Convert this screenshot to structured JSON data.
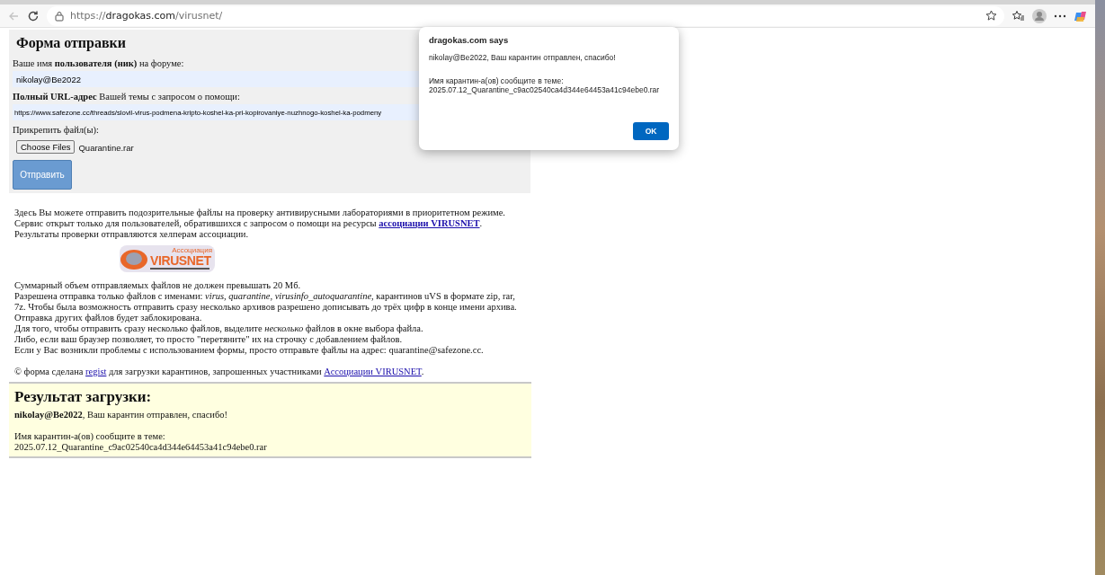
{
  "browser": {
    "url_scheme": "https://",
    "url_host": "dragokas.com",
    "url_path": "/virusnet/",
    "back_disabled": true
  },
  "form": {
    "title": "Форма отправки",
    "fields": [
      {
        "kind": "text",
        "label": "Ваше имя **пользователя (ник)** на форуме:",
        "value": "nikolay@Be2022"
      },
      {
        "kind": "text",
        "label": "**Полный URL-адрес** Вашей темы с запросом о помощи:",
        "value": "https://www.safezone.cc/threads/slovil-virus-podmena-kripto-koshel-ka-pri-kopirovaniye-nuzhnogo-koshel-ka-podmeny"
      },
      {
        "kind": "file",
        "label": "Прикрепить файл(ы):",
        "button": "Choose Files",
        "value": "Quarantine.rar"
      }
    ],
    "submit": "Отправить"
  },
  "intro": [
    [
      {
        "kind": "text",
        "text": "Здесь Вы можете отправить подозрительные файлы на проверку антивирусными лабораториями в приоритетном режиме."
      }
    ],
    [
      {
        "kind": "text",
        "text": "Сервис открыт только для пользователей, обратившихся с запросом о помощи на ресурсы "
      },
      {
        "kind": "bold-link",
        "text": "ассоциации VIRUSNET"
      },
      {
        "kind": "text",
        "text": "."
      }
    ],
    [
      {
        "kind": "text",
        "text": "Результаты проверки отправляются хелперам ассоциации."
      }
    ]
  ],
  "logo": {
    "caption": "Ассоциация",
    "name": "VIRUSNET"
  },
  "rules": [
    [
      {
        "kind": "text",
        "text": "Суммарный объем отправляемых файлов не должен превышать 20 Мб."
      }
    ],
    [
      {
        "kind": "text",
        "text": "Разрешена отправка только файлов с именами: *virus*, *quarantine*, *virusinfo_autoquarantine*, карантинов uVS в формате zip, rar, 7z. Чтобы была возможность отправить сразу несколько архивов разрешено дописывать до трёх цифр в конце имени архива."
      }
    ],
    [
      {
        "kind": "text",
        "text": "Отправка других файлов будет заблокирована."
      }
    ],
    [
      {
        "kind": "text",
        "text": "Для того, чтобы отправить сразу несколько файлов, выделите *несколько* файлов в окне выбора файла."
      }
    ],
    [
      {
        "kind": "text",
        "text": "Либо, если ваш браузер позволяет, то просто \"перетяните\" их на строчку с добавлением файлов."
      }
    ],
    [
      {
        "kind": "text",
        "text": "Если у Вас возникли проблемы с использованием формы, просто отправьте файлы на адрес: quarantine@safezone.cc."
      }
    ]
  ],
  "credits": [
    {
      "kind": "text",
      "text": "© форма сделана "
    },
    {
      "kind": "link",
      "text": "regist"
    },
    {
      "kind": "text",
      "text": " для загрузки карантинов, запрошенных участниками "
    },
    {
      "kind": "link",
      "text": "Ассоциации VIRUSNET"
    },
    {
      "kind": "text",
      "text": "."
    }
  ],
  "result": {
    "title": "Результат загрузки:",
    "message": "**nikolay@Be2022**, Ваш карантин отправлен, спасибо!",
    "name_label": "Имя карантин-а(ов) сообщите в теме:",
    "file_name": "2025.07.12_Quarantine_c9ac02540ca4d344e64453a41c94ebe0.rar"
  },
  "dialog": {
    "title": "dragokas.com says",
    "message": "nikolay@Be2022, Ваш карантин отправлен, спасибо!",
    "name_label": "Имя карантин-а(ов) сообщите в теме:",
    "file_name": "2025.07.12_Quarantine_c9ac02540ca4d344e64453a41c94ebe0.rar",
    "button": "OK"
  }
}
